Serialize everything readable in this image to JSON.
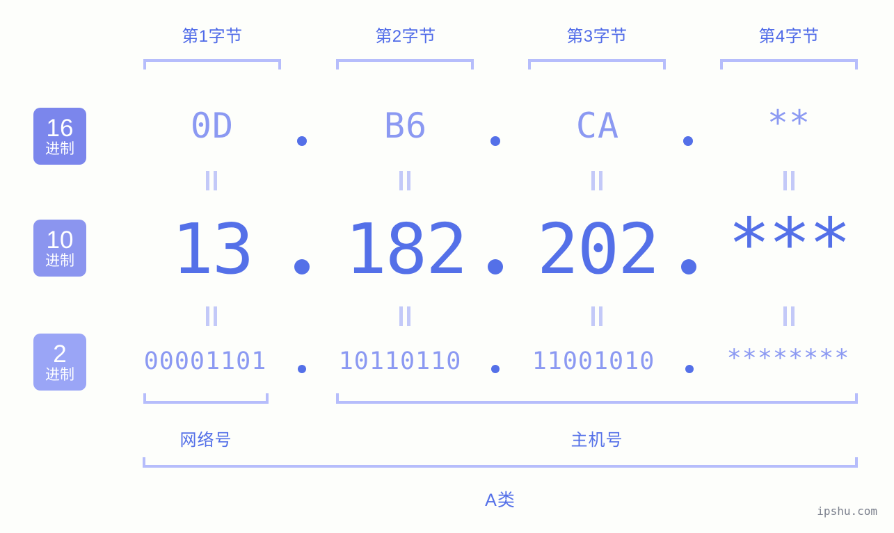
{
  "watermark": "ipshu.com",
  "colors": {
    "background": "#fdfefb",
    "accent_strong": "#5470e8",
    "accent_soft": "#8b99f2",
    "bracket": "#b6bdfb",
    "badge_hex": "#7b86ec",
    "badge_dec": "#8b95ef",
    "badge_bin": "#9aa5f6",
    "separator": "#c3c9f8",
    "watermark": "#7a7f8c"
  },
  "byte_headers": [
    {
      "label": "第1字节"
    },
    {
      "label": "第2字节"
    },
    {
      "label": "第3字节"
    },
    {
      "label": "第4字节"
    }
  ],
  "bases": [
    {
      "number": "16",
      "unit": "进制"
    },
    {
      "number": "10",
      "unit": "进制"
    },
    {
      "number": "2",
      "unit": "进制"
    }
  ],
  "separator_dot": ".",
  "rows": {
    "hex": {
      "base": "16",
      "values": [
        "0D",
        "B6",
        "CA",
        "**"
      ]
    },
    "decimal": {
      "base": "10",
      "values": [
        "13",
        "182",
        "202",
        "***"
      ]
    },
    "binary": {
      "base": "2",
      "values": [
        "00001101",
        "10110110",
        "11001010",
        "********"
      ]
    }
  },
  "equals_symbol": "=",
  "parts": [
    {
      "label": "网络号"
    },
    {
      "label": "主机号"
    }
  ],
  "ip_class": {
    "label": "A类"
  }
}
